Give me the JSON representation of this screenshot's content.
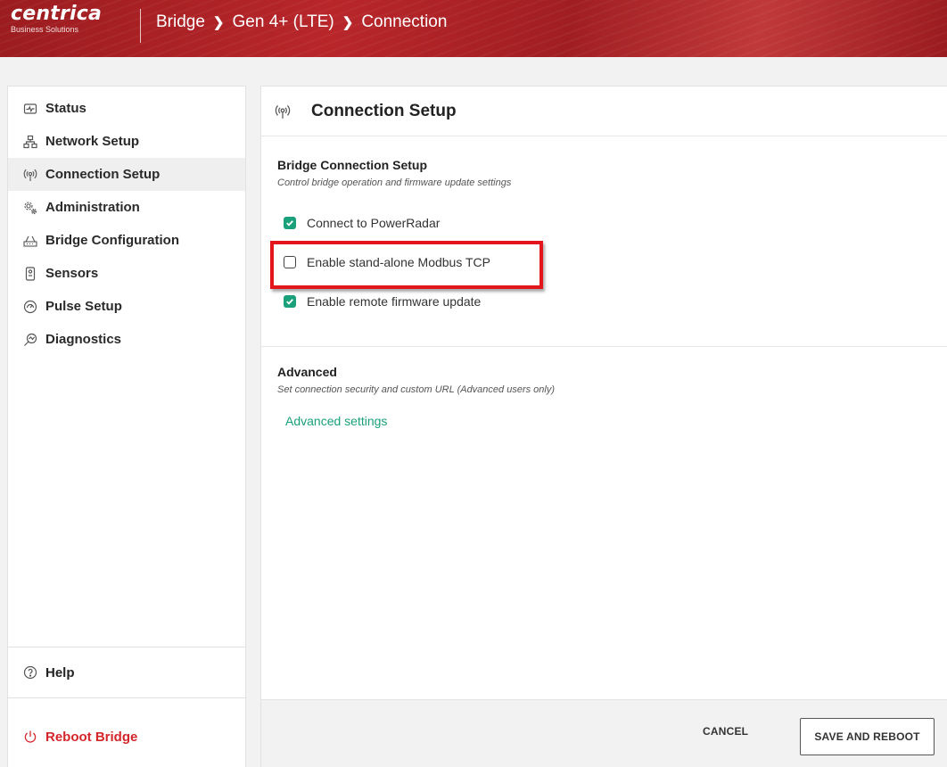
{
  "header": {
    "logo_main": "centrica",
    "logo_sub": "Business Solutions",
    "breadcrumb": [
      "Bridge",
      "Gen 4+ (LTE)",
      "Connection"
    ]
  },
  "sidebar": {
    "items": [
      {
        "label": "Status",
        "icon": "status-icon"
      },
      {
        "label": "Network Setup",
        "icon": "network-icon"
      },
      {
        "label": "Connection Setup",
        "icon": "antenna-icon",
        "active": true
      },
      {
        "label": "Administration",
        "icon": "gears-icon"
      },
      {
        "label": "Bridge Configuration",
        "icon": "router-icon"
      },
      {
        "label": "Sensors",
        "icon": "sensor-icon"
      },
      {
        "label": "Pulse Setup",
        "icon": "gauge-icon"
      },
      {
        "label": "Diagnostics",
        "icon": "diagnostics-icon"
      }
    ],
    "help_label": "Help",
    "reboot_label": "Reboot Bridge"
  },
  "main": {
    "title": "Connection Setup",
    "bridge_section": {
      "title": "Bridge Connection Setup",
      "subtitle": "Control bridge operation and firmware update settings",
      "options": [
        {
          "label": "Connect to PowerRadar",
          "checked": true
        },
        {
          "label": "Enable stand-alone Modbus TCP",
          "checked": false
        },
        {
          "label": "Enable remote firmware update",
          "checked": true
        }
      ]
    },
    "advanced_section": {
      "title": "Advanced",
      "subtitle": "Set connection security and custom URL (Advanced users only)",
      "link": "Advanced settings"
    },
    "footer": {
      "cancel_label": "CANCEL",
      "save_label": "SAVE AND REBOOT"
    }
  },
  "colors": {
    "brand_red": "#b8262a",
    "accent_green": "#1aa07a",
    "highlight_red": "#e3161c",
    "reboot_red": "#d4252b"
  }
}
